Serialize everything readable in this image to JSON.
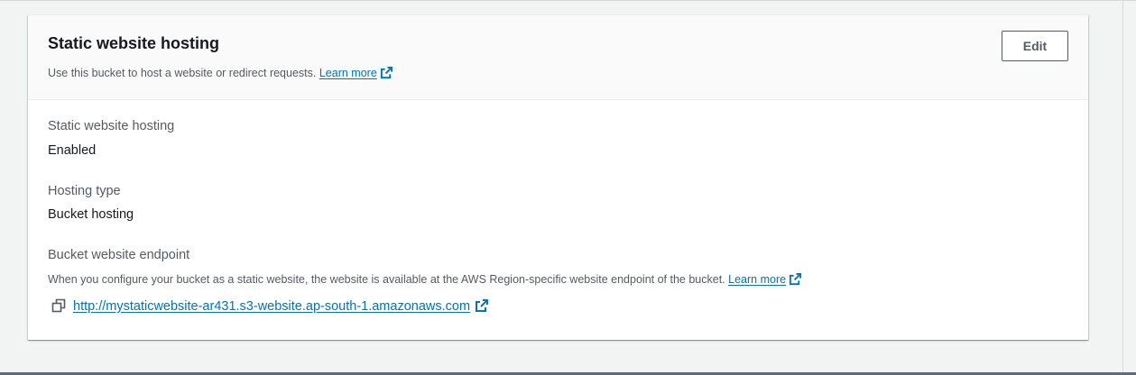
{
  "panel": {
    "title": "Static website hosting",
    "description": "Use this bucket to host a website or redirect requests.",
    "learn_more": "Learn more",
    "edit_label": "Edit"
  },
  "fields": {
    "hosting": {
      "label": "Static website hosting",
      "value": "Enabled"
    },
    "hosting_type": {
      "label": "Hosting type",
      "value": "Bucket hosting"
    },
    "endpoint": {
      "label": "Bucket website endpoint",
      "help": "When you configure your bucket as a static website, the website is available at the AWS Region-specific website endpoint of the bucket.",
      "learn_more": "Learn more",
      "url": "http://mystaticwebsite-ar431.s3-website.ap-south-1.amazonaws.com"
    }
  },
  "icons": {
    "external": "external-link-icon",
    "copy": "copy-icon"
  },
  "colors": {
    "link": "#0073bb",
    "text": "#16191f",
    "muted": "#545b64",
    "header_bg": "#fafafa",
    "page_bg": "#f2f3f3"
  }
}
